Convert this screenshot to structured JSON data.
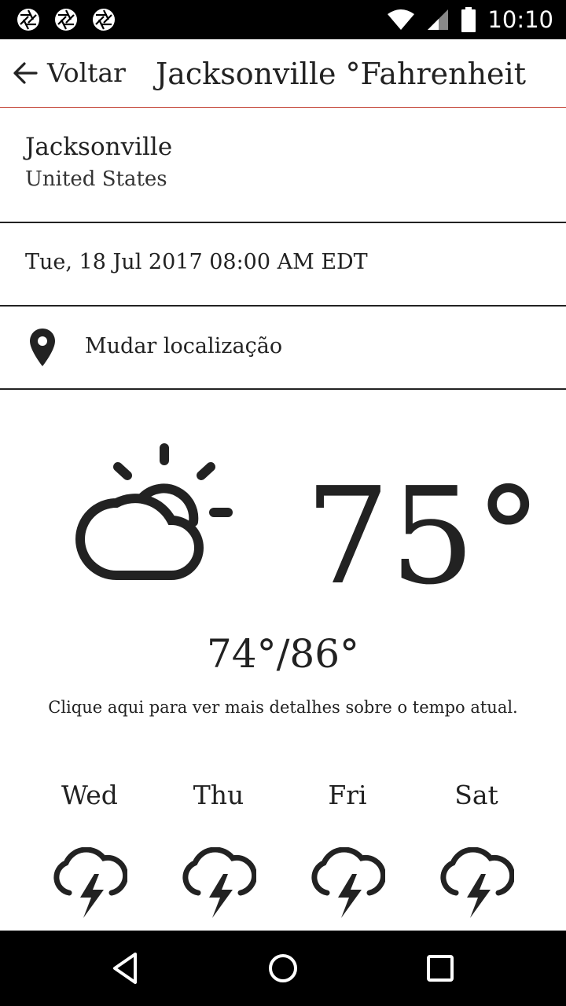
{
  "status_bar": {
    "time": "10:10",
    "left_icons": [
      "camera-aperture-icon",
      "camera-aperture-icon",
      "camera-aperture-icon"
    ],
    "right_icons": [
      "wifi-icon",
      "cell-signal-icon",
      "battery-icon"
    ]
  },
  "toolbar": {
    "back_label": "Voltar",
    "title": "Jacksonville °Fahrenheit",
    "accent_color": "#c0392b"
  },
  "location": {
    "city": "Jacksonville",
    "country": "United States"
  },
  "date_time": "Tue, 18 Jul 2017 08:00 AM EDT",
  "change_location_label": "Mudar localização",
  "current": {
    "icon": "partly-cloudy-icon",
    "temperature": "75°",
    "range": "74°/86°",
    "details_link": "Clique aqui para ver mais detalhes sobre o tempo atual."
  },
  "forecast": [
    {
      "day": "Wed",
      "icon": "thunderstorm-icon"
    },
    {
      "day": "Thu",
      "icon": "thunderstorm-icon"
    },
    {
      "day": "Fri",
      "icon": "thunderstorm-icon"
    },
    {
      "day": "Sat",
      "icon": "thunderstorm-icon"
    }
  ],
  "nav_bar": {
    "buttons": [
      "back-triangle-icon",
      "home-circle-icon",
      "recents-square-icon"
    ]
  }
}
